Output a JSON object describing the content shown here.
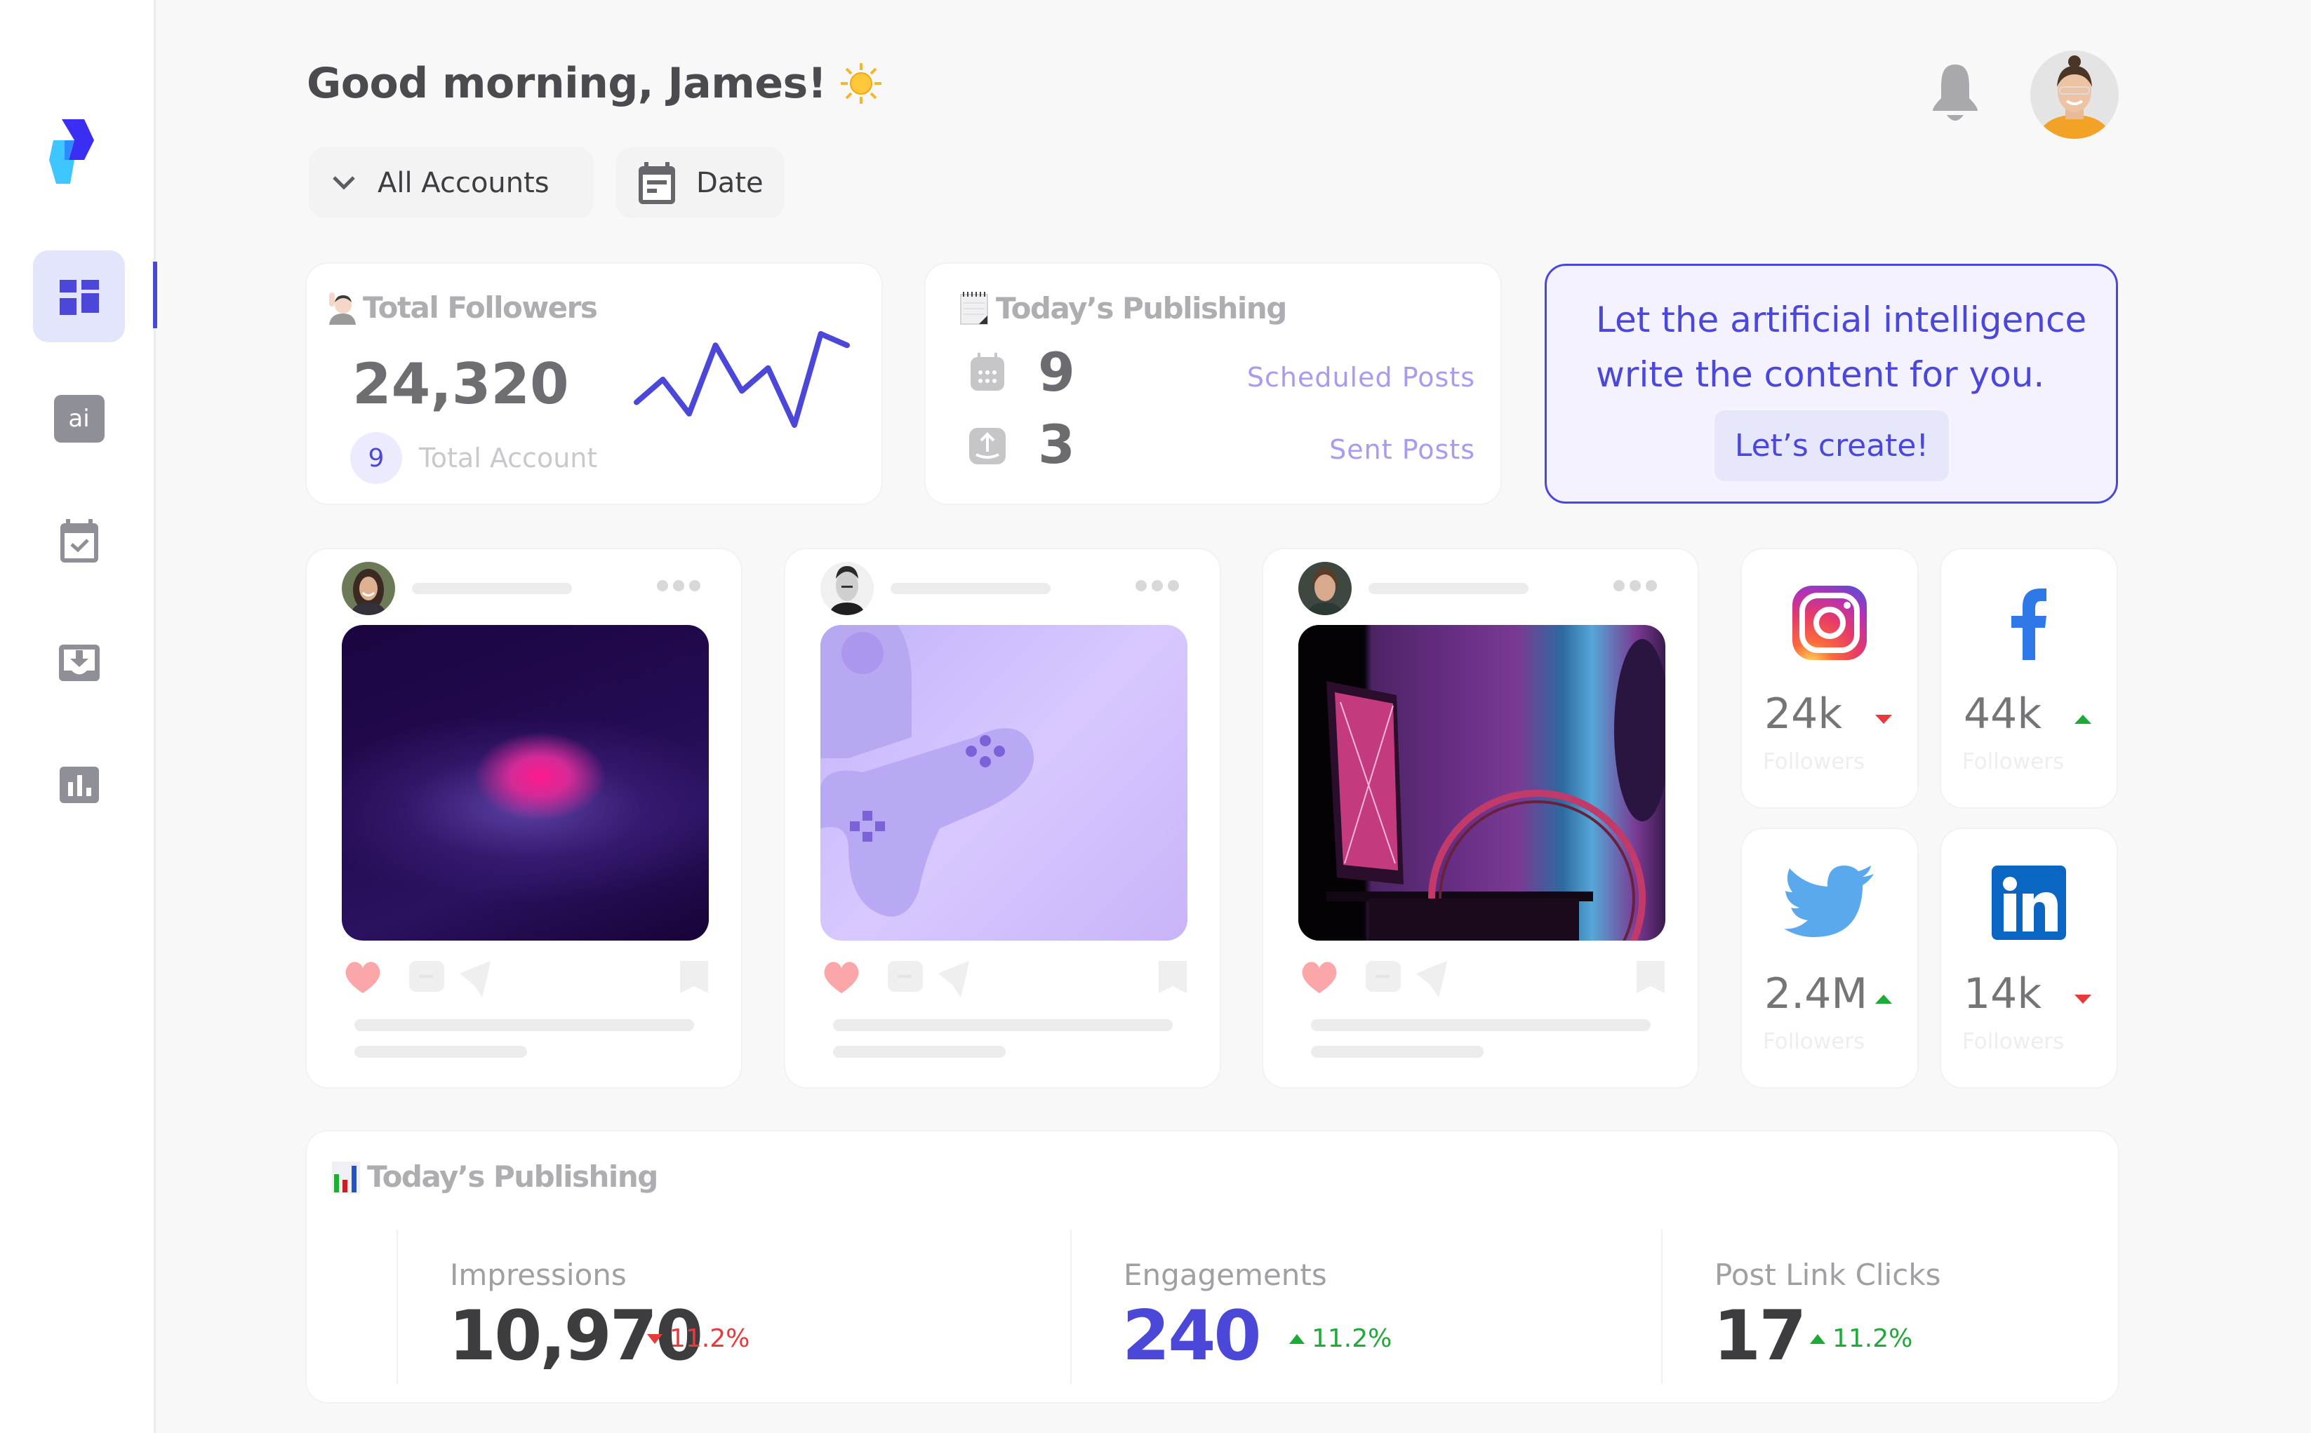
{
  "header": {
    "greeting": "Good morning, James!",
    "greeting_icon": "sun-icon",
    "notifications_icon": "bell-icon",
    "avatar": "user-avatar"
  },
  "filters": {
    "accounts_label": "All Accounts",
    "accounts_icon": "chevron-down-icon",
    "date_label": "Date",
    "date_icon": "calendar-icon"
  },
  "sidebar": {
    "items": [
      {
        "name": "dashboard",
        "icon": "dashboard-icon",
        "active": true
      },
      {
        "name": "ai",
        "icon": "ai-icon",
        "label": "ai",
        "active": false
      },
      {
        "name": "calendar",
        "icon": "calendar-check-icon",
        "active": false
      },
      {
        "name": "inbox",
        "icon": "inbox-download-icon",
        "active": false
      },
      {
        "name": "analytics",
        "icon": "bar-chart-icon",
        "active": false
      }
    ],
    "accent": "#4b47d9"
  },
  "followers_card": {
    "title": "Total Followers",
    "value": "24,320",
    "account_count": "9",
    "account_label": "Total Account",
    "sparkline": [
      3,
      5,
      2,
      8,
      4,
      6,
      1,
      9,
      8
    ]
  },
  "publishing_card": {
    "title": "Today’s Publishing",
    "scheduled_value": "9",
    "scheduled_label": "Scheduled Posts",
    "sent_value": "3",
    "sent_label": "Sent Posts"
  },
  "ai_card": {
    "text": "Let the artificial intelligence write the content for you.",
    "button_label": "Let’s create!"
  },
  "posts": [
    {
      "image": "abstract-purple-wave"
    },
    {
      "image": "purple-game-controller"
    },
    {
      "image": "neon-room-bicycle"
    }
  ],
  "socials": [
    {
      "network": "Instagram",
      "icon": "instagram-icon",
      "value": "24k",
      "label": "Followers",
      "trend": "down"
    },
    {
      "network": "Facebook",
      "icon": "facebook-icon",
      "value": "44k",
      "label": "Followers",
      "trend": "up"
    },
    {
      "network": "Twitter",
      "icon": "twitter-icon",
      "value": "2.4M",
      "label": "Followers",
      "trend": "up"
    },
    {
      "network": "LinkedIn",
      "icon": "linkedin-icon",
      "value": "14k",
      "label": "Followers",
      "trend": "down"
    }
  ],
  "stats": {
    "title": "Today’s Publishing",
    "items": [
      {
        "label": "Impressions",
        "value": "10,970",
        "change": "11.2%",
        "trend": "down",
        "value_color": "#3d3d40"
      },
      {
        "label": "Engagements",
        "value": "240",
        "change": "11.2%",
        "trend": "up",
        "value_color": "#4b47d9"
      },
      {
        "label": "Post Link Clicks",
        "value": "17",
        "change": "11.2%",
        "trend": "up",
        "value_color": "#3d3d40"
      }
    ]
  },
  "colors": {
    "up": "#1eaa36",
    "down": "#e83a3a"
  }
}
